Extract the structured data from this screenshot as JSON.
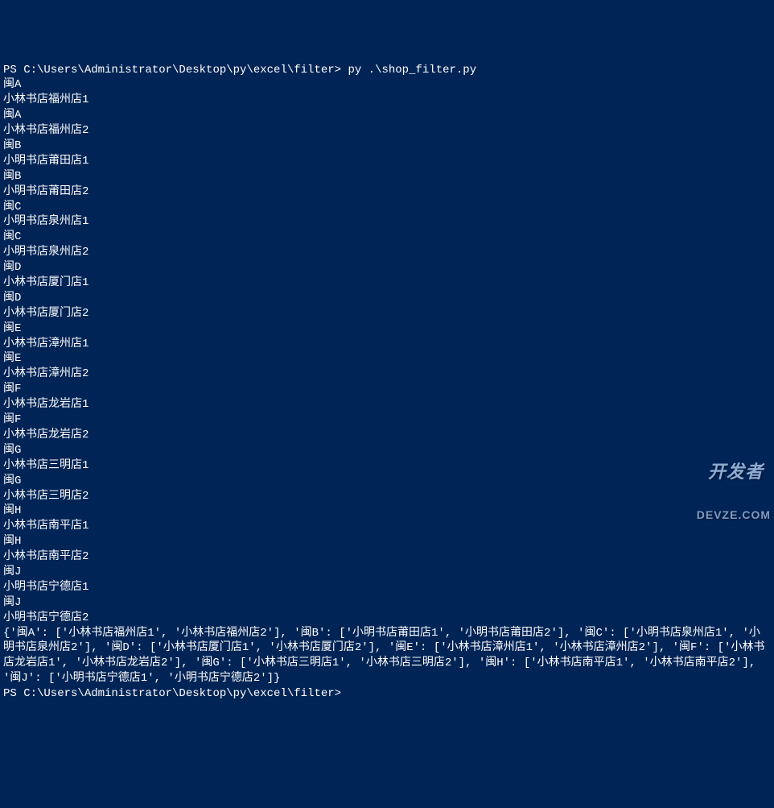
{
  "prompt1": "PS C:\\Users\\Administrator\\Desktop\\py\\excel\\filter> py .\\shop_filter.py",
  "output_lines": [
    "闽A",
    "小林书店福州店1",
    "闽A",
    "小林书店福州店2",
    "闽B",
    "小明书店莆田店1",
    "闽B",
    "小明书店莆田店2",
    "闽C",
    "小明书店泉州店1",
    "闽C",
    "小明书店泉州店2",
    "闽D",
    "小林书店厦门店1",
    "闽D",
    "小林书店厦门店2",
    "闽E",
    "小林书店漳州店1",
    "闽E",
    "小林书店漳州店2",
    "闽F",
    "小林书店龙岩店1",
    "闽F",
    "小林书店龙岩店2",
    "闽G",
    "小林书店三明店1",
    "闽G",
    "小林书店三明店2",
    "闽H",
    "小林书店南平店1",
    "闽H",
    "小林书店南平店2",
    "闽J",
    "小明书店宁德店1",
    "闽J",
    "小明书店宁德店2"
  ],
  "dict_output": "{'闽A': ['小林书店福州店1', '小林书店福州店2'], '闽B': ['小明书店莆田店1', '小明书店莆田店2'], '闽C': ['小明书店泉州店1', '小明书店泉州店2'], '闽D': ['小林书店厦门店1', '小林书店厦门店2'], '闽E': ['小林书店漳州店1', '小林书店漳州店2'], '闽F': ['小林书店龙岩店1', '小林书店龙岩店2'], '闽G': ['小林书店三明店1', '小林书店三明店2'], '闽H': ['小林书店南平店1', '小林书店南平店2'], '闽J': ['小明书店宁德店1', '小明书店宁德店2']}",
  "prompt2": "PS C:\\Users\\Administrator\\Desktop\\py\\excel\\filter>",
  "watermark_main": "开发者",
  "watermark_sub": "DEVZE.COM"
}
